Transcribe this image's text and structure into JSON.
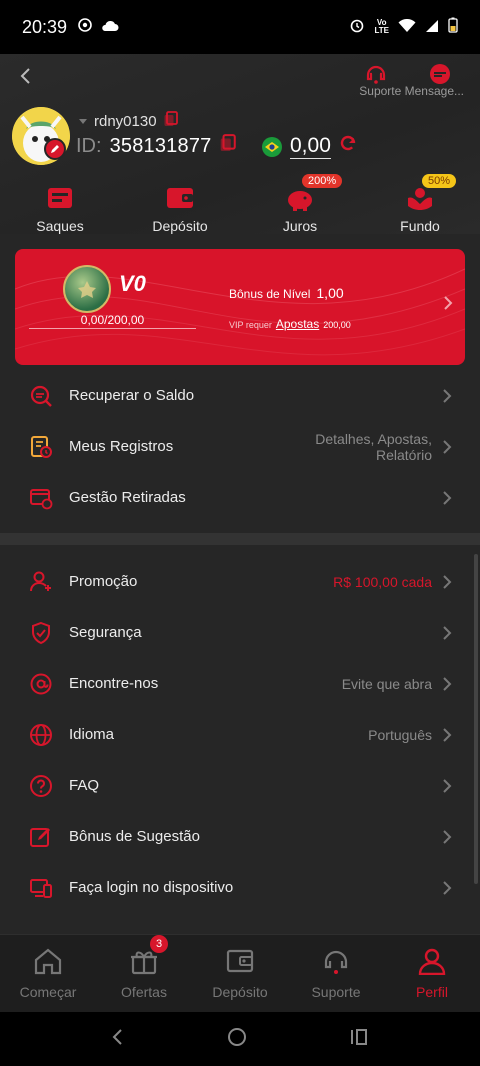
{
  "status_bar": {
    "time": "20:39",
    "network": "LTE"
  },
  "header": {
    "support_label": "Suporte Mensage..."
  },
  "profile": {
    "username": "rdny0130",
    "id_label": "ID:",
    "id_value": "358131877",
    "balance": "0,00"
  },
  "quick_actions": [
    {
      "label": "Saques",
      "badge": ""
    },
    {
      "label": "Depósito",
      "badge": ""
    },
    {
      "label": "Juros",
      "badge": "200%"
    },
    {
      "label": "Fundo",
      "badge": "50%"
    }
  ],
  "vip": {
    "level": "V0",
    "progress_text": "0,00/200,00",
    "bonus_label": "Bônus de Nível",
    "bonus_value": "1,00",
    "req_label": "VIP requer",
    "req_link": "Apostas",
    "req_amount": "200,00"
  },
  "menu1": [
    {
      "label": "Recuperar o Saldo",
      "value": ""
    },
    {
      "label": "Meus Registros",
      "value_line1": "Detalhes, Apostas,",
      "value_line2": "Relatório"
    },
    {
      "label": "Gestão Retiradas",
      "value": ""
    }
  ],
  "menu2": [
    {
      "label": "Promoção",
      "value": "R$ 100,00 cada"
    },
    {
      "label": "Segurança",
      "value": ""
    },
    {
      "label": "Encontre-nos",
      "value": "Evite que abra"
    },
    {
      "label": "Idioma",
      "value": "Português"
    },
    {
      "label": "FAQ",
      "value": ""
    },
    {
      "label": "Bônus de Sugestão",
      "value": ""
    },
    {
      "label": "Faça login no dispositivo",
      "value": ""
    }
  ],
  "tabs": [
    {
      "label": "Começar"
    },
    {
      "label": "Ofertas",
      "badge": "3"
    },
    {
      "label": "Depósito"
    },
    {
      "label": "Suporte"
    },
    {
      "label": "Perfil"
    }
  ],
  "colors": {
    "accent": "#d7162b",
    "background": "#262626",
    "tabbar": "#1e1e1e"
  }
}
